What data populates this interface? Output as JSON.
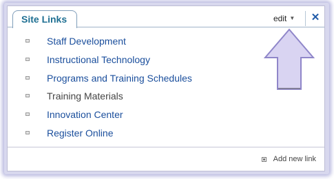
{
  "widget": {
    "title": "Site Links",
    "edit_label": "edit",
    "close_label": "✕"
  },
  "links": [
    {
      "label": "Staff Development"
    },
    {
      "label": "Instructional Technology"
    },
    {
      "label": "Programs and Training Schedules"
    },
    {
      "label": "Training Materials"
    },
    {
      "label": "Innovation Center"
    },
    {
      "label": "Register Online"
    }
  ],
  "footer": {
    "add_link_label": "Add new link"
  },
  "colors": {
    "link": "#1a4e9c",
    "title": "#1e6f92",
    "arrow_fill": "#d9d4f2",
    "arrow_stroke": "#8f86c9"
  },
  "annotation": {
    "icon": "up-arrow-icon"
  }
}
